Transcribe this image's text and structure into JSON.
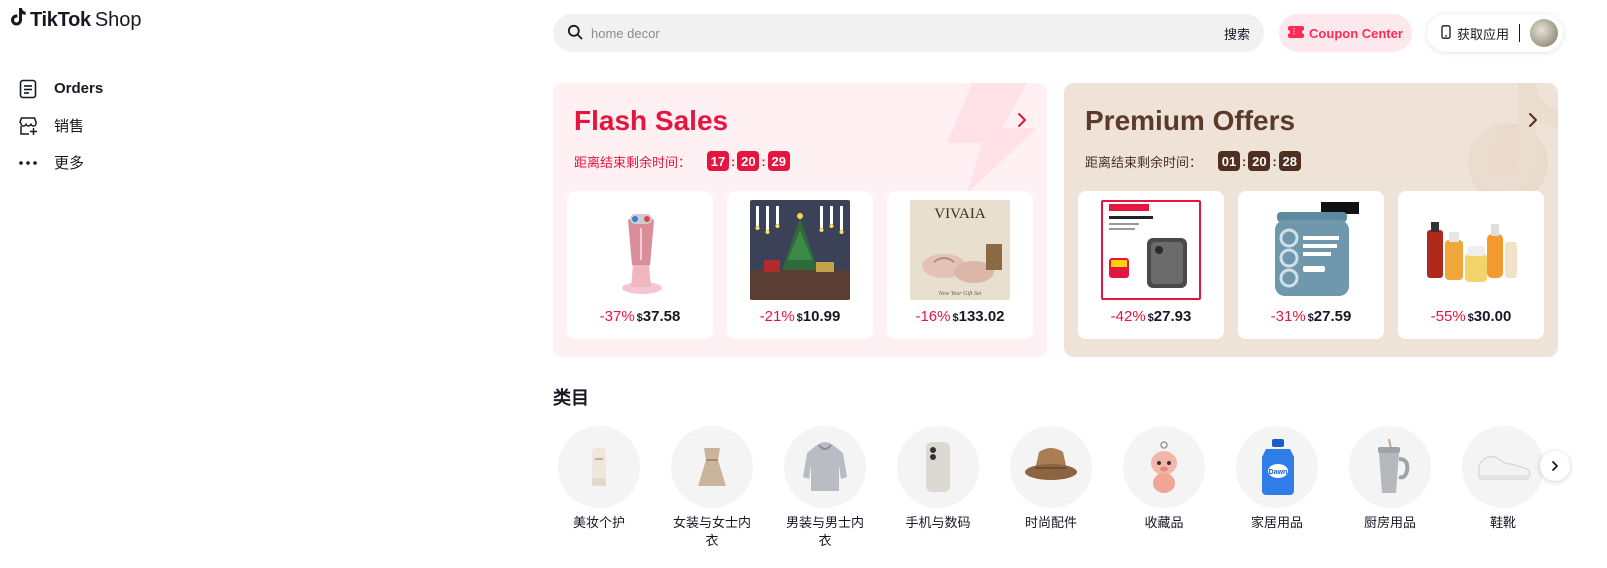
{
  "header": {
    "logo": {
      "brand_bold": "TikTok",
      "brand_light": "Shop",
      "icon": "tiktok-note-icon"
    },
    "search": {
      "placeholder": "home decor",
      "button_label": "搜索",
      "icon": "search-icon"
    },
    "coupon": {
      "label": "Coupon Center",
      "icon": "ticket-icon",
      "color": "#fe2c55"
    },
    "get_app": {
      "label": "获取应用",
      "icon": "phone-icon"
    }
  },
  "sidebar": {
    "items": [
      {
        "label": "Orders",
        "icon": "orders-icon"
      },
      {
        "label": "销售",
        "icon": "store-add-icon"
      },
      {
        "label": "更多",
        "icon": "more-dots-icon"
      }
    ]
  },
  "promos": {
    "flash": {
      "title": "Flash Sales",
      "timer_label": "距离结束剩余时间：",
      "timer": {
        "h": "17",
        "m": "20",
        "s": "29"
      },
      "accent": "#e5153f",
      "products": [
        {
          "discount": "-37%",
          "currency": "$",
          "price": "37.58",
          "image": "beauty-device"
        },
        {
          "discount": "-21%",
          "currency": "$",
          "price": "10.99",
          "image": "christmas-candles"
        },
        {
          "discount": "-16%",
          "currency": "$",
          "price": "133.02",
          "image": "vivaia-shoes"
        }
      ]
    },
    "premium": {
      "title": "Premium Offers",
      "timer_label": "距离结束剩余时间：",
      "timer": {
        "h": "01",
        "m": "20",
        "s": "28"
      },
      "accent": "#4f2f1f",
      "products": [
        {
          "discount": "-42%",
          "currency": "$",
          "price": "27.93",
          "image": "anker-powerbank"
        },
        {
          "discount": "-31%",
          "currency": "$",
          "price": "27.59",
          "image": "collagen-tub"
        },
        {
          "discount": "-55%",
          "currency": "$",
          "price": "30.00",
          "image": "skincare-set"
        }
      ]
    }
  },
  "categories": {
    "title": "类目",
    "items": [
      {
        "label": "美妆个护",
        "icon": "cosmetics-icon"
      },
      {
        "label": "女装与女士内衣",
        "icon": "dress-icon"
      },
      {
        "label": "男装与男士内衣",
        "icon": "hoodie-icon"
      },
      {
        "label": "手机与数码",
        "icon": "phone-icon"
      },
      {
        "label": "时尚配件",
        "icon": "bucket-hat-icon"
      },
      {
        "label": "收藏品",
        "icon": "collectible-icon"
      },
      {
        "label": "家居用品",
        "icon": "detergent-icon"
      },
      {
        "label": "厨房用品",
        "icon": "tumbler-icon"
      },
      {
        "label": "鞋靴",
        "icon": "sneaker-icon"
      }
    ]
  }
}
